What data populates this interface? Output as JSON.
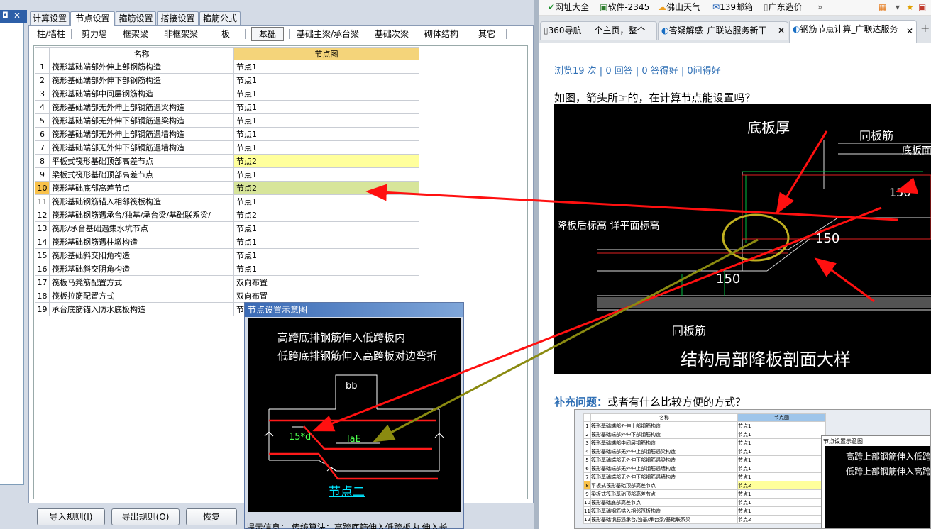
{
  "left_app": {
    "tabs": [
      "计算设置",
      "节点设置",
      "箍筋设置",
      "搭接设置",
      "箍筋公式"
    ],
    "active_tab": "节点设置",
    "subtabs": [
      "柱/墙柱",
      "剪力墙",
      "框架梁",
      "非框架梁",
      "板",
      "基础",
      "基础主梁/承台梁",
      "基础次梁",
      "砌体结构",
      "其它"
    ],
    "active_subtab": "基础",
    "grid": {
      "headers": [
        "名称",
        "节点图"
      ],
      "rows": [
        {
          "no": "1",
          "name": "筏形基础端部外伸上部钢筋构造",
          "node": "节点1"
        },
        {
          "no": "2",
          "name": "筏形基础端部外伸下部钢筋构造",
          "node": "节点1"
        },
        {
          "no": "3",
          "name": "筏形基础端部中间层钢筋构造",
          "node": "节点1"
        },
        {
          "no": "4",
          "name": "筏形基础端部无外伸上部钢筋遇梁构造",
          "node": "节点1"
        },
        {
          "no": "5",
          "name": "筏形基础端部无外伸下部钢筋遇梁构造",
          "node": "节点1"
        },
        {
          "no": "6",
          "name": "筏形基础端部无外伸上部钢筋遇墙构造",
          "node": "节点1"
        },
        {
          "no": "7",
          "name": "筏形基础端部无外伸下部钢筋遇墙构造",
          "node": "节点1"
        },
        {
          "no": "8",
          "name": "平板式筏形基础顶部高差节点",
          "node": "节点2"
        },
        {
          "no": "9",
          "name": "梁板式筏形基础顶部高差节点",
          "node": "节点1"
        },
        {
          "no": "10",
          "name": "筏形基础底部高差节点",
          "node": "节点2"
        },
        {
          "no": "11",
          "name": "筏形基础钢筋锚入相邻筏板构造",
          "node": "节点1"
        },
        {
          "no": "12",
          "name": "筏形基础钢筋遇承台/独基/承台梁/基础联系梁/",
          "node": "节点2"
        },
        {
          "no": "13",
          "name": "筏形/承台基础遇集水坑节点",
          "node": "节点1"
        },
        {
          "no": "14",
          "name": "筏形基础钢筋遇柱墩构造",
          "node": "节点1"
        },
        {
          "no": "15",
          "name": "筏形基础斜交阳角构造",
          "node": "节点1"
        },
        {
          "no": "16",
          "name": "筏形基础斜交阴角构造",
          "node": "节点1"
        },
        {
          "no": "17",
          "name": "筏板马凳筋配置方式",
          "node": "双向布置"
        },
        {
          "no": "18",
          "name": "筏板拉筋配置方式",
          "node": "双向布置"
        },
        {
          "no": "19",
          "name": "承台底筋锚入防水底板构造",
          "node": "节"
        }
      ]
    },
    "buttons": [
      "导入规则(I)",
      "导出规则(O)",
      "恢复"
    ],
    "colors": {
      "highlight_row": "#ffff9c",
      "selected_cell": "#d7e59a",
      "header_node": "#f4d47a"
    }
  },
  "popup": {
    "title": "节点设置示意图",
    "line1": "高跨底排钢筋伸入低跨板内",
    "line2": "低跨底排钢筋伸入高跨板对边弯折",
    "label_bb": "bb",
    "label_15d": "15*d",
    "label_lae": "laE",
    "caption": "节点二",
    "tip": "提示信息：  传统算法：高跨底筋伸入低跨板内 伸入长"
  },
  "browser": {
    "bookmarks": [
      "网址大全",
      "软件-2345",
      "佛山天气",
      "139邮箱",
      "广东造价"
    ],
    "tabs": [
      "360导航_一个主页，整个",
      "答疑解惑_广联达服务新干",
      "钢筋节点计算_广联达服务"
    ],
    "stats": "浏览19 次 | 0 回答 | 0 答得好 | 0问得好",
    "question": "如图，箭头所☞的，在计算节点能设置吗？",
    "cad_labels": [
      "底板厚",
      "同板筋",
      "底板面标",
      "降板后标高 详平面标高",
      "150",
      "150",
      "150",
      "同板筋",
      "结构局部降板剖面大样"
    ],
    "supp_label": "补充问题：",
    "supp_text": "或者有什么比较方便的方式？",
    "thumb": {
      "headers": [
        "名称",
        "节点图"
      ],
      "popup_title": "节点设置示意图",
      "popup_lines": [
        "高跨上部钢筋伸入低跨",
        "低跨上部钢筋伸入高跨"
      ],
      "rows": [
        {
          "no": "1",
          "name": "筏形基础端部外伸上部钢筋构造",
          "node": "节点1"
        },
        {
          "no": "2",
          "name": "筏形基础端部外伸下部钢筋构造",
          "node": "节点1"
        },
        {
          "no": "3",
          "name": "筏形基础端部中间层钢筋构造",
          "node": "节点1"
        },
        {
          "no": "4",
          "name": "筏形基础端部无外伸上部钢筋遇梁构造",
          "node": "节点1"
        },
        {
          "no": "5",
          "name": "筏形基础端部无外伸下部钢筋遇梁构造",
          "node": "节点1"
        },
        {
          "no": "6",
          "name": "筏形基础端部无外伸上部钢筋遇墙构造",
          "node": "节点1"
        },
        {
          "no": "7",
          "name": "筏形基础端部无外伸下部钢筋遇墙构造",
          "node": "节点1"
        },
        {
          "no": "8",
          "name": "平板式筏形基础顶部高差节点",
          "node": "节点2"
        },
        {
          "no": "9",
          "name": "梁板式筏形基础顶部高差节点",
          "node": "节点1"
        },
        {
          "no": "10",
          "name": "筏形基础底部高差节点",
          "node": "节点1"
        },
        {
          "no": "11",
          "name": "筏形基础钢筋锚入相邻筏板构造",
          "node": "节点1"
        },
        {
          "no": "12",
          "name": "筏形基础钢筋遇承台/独基/承台梁/基础联系梁",
          "node": "节点2"
        }
      ]
    }
  }
}
